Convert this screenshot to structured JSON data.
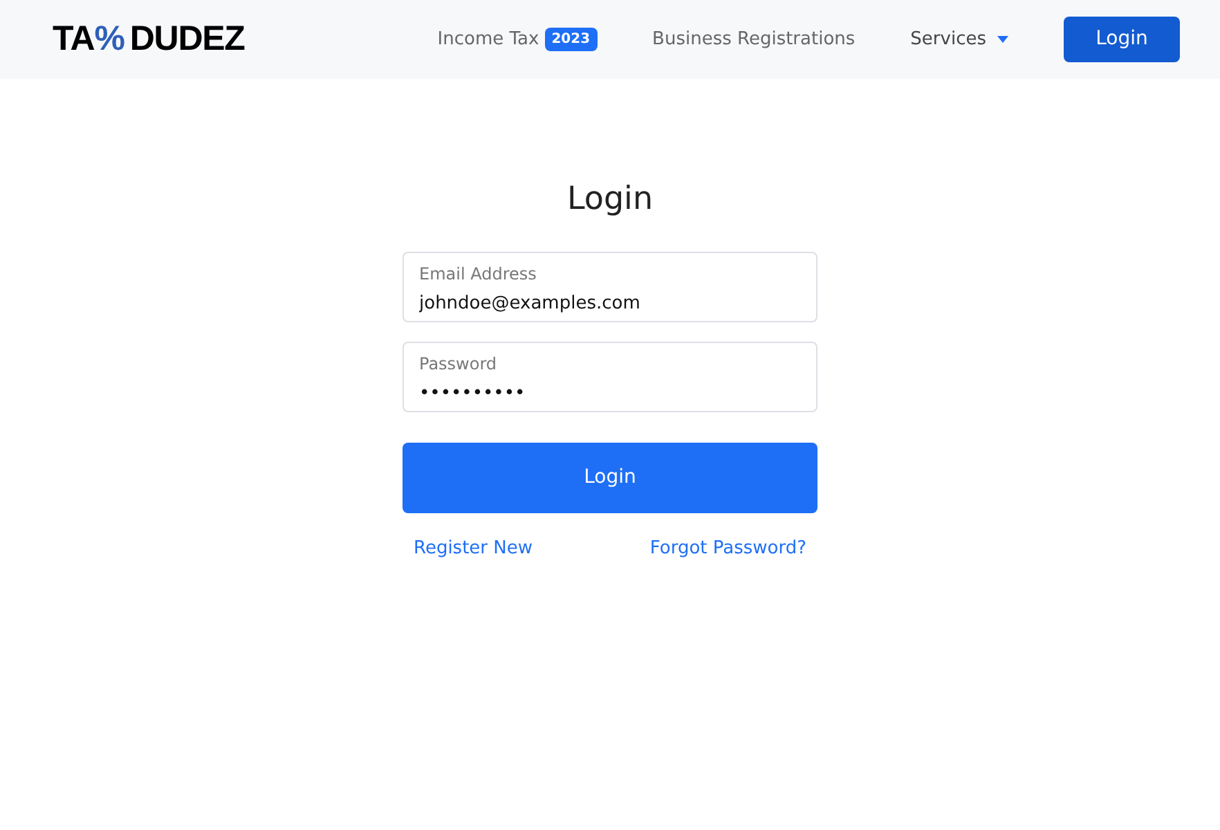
{
  "logo": {
    "left": "TA",
    "symbol": "%",
    "right": "DUDEZ"
  },
  "nav": [
    {
      "kind": "badge",
      "label": "Income Tax",
      "badge": "2023"
    },
    {
      "kind": "link",
      "label": "Business Registrations"
    },
    {
      "kind": "dropdown",
      "label": "Services"
    }
  ],
  "header_button": "Login",
  "form": {
    "title": "Login",
    "fields": [
      {
        "label": "Email Address",
        "value": "johndoe@examples.com"
      },
      {
        "label": "Password",
        "value": "••••••••••"
      }
    ],
    "submit": "Login",
    "links": [
      "Register New",
      "Forgot Password?"
    ]
  }
}
